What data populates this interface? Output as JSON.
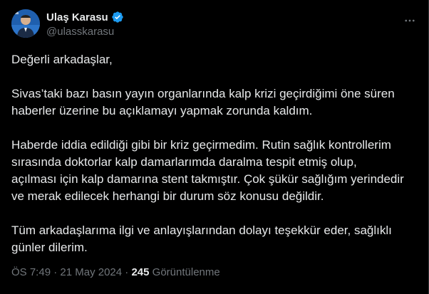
{
  "author": {
    "display_name": "Ulaş Karasu",
    "handle": "@ulasskarasu",
    "verified": true
  },
  "tweet": {
    "paragraphs": [
      "Değerli arkadaşlar,",
      "Sivas’taki bazı basın yayın organlarında kalp krizi geçirdiğimi öne süren\nhaberler üzerine bu açıklamayı yapmak zorunda kaldım.",
      "Haberde iddia edildiği gibi bir kriz geçirmedim. Rutin sağlık kontrollerim\nsırasında doktorlar kalp damarlarımda daralma tespit etmiş olup,\naçılması için kalp damarına stent takmıştır. Çok şükür sağlığım yerindedir\nve merak edilecek herhangi bir durum söz konusu değildir.",
      "Tüm arkadaşlarıma ilgi ve anlayışlarından dolayı teşekkür eder, sağlıklı\ngünler dilerim."
    ]
  },
  "meta": {
    "time": "ÖS 7:49",
    "separator": " · ",
    "date": "21 May 2024",
    "views_count": "245",
    "views_label": " Görüntülenme"
  },
  "icons": {
    "verified": "verified-badge-icon",
    "more": "more-options-icon"
  },
  "colors": {
    "background": "#000000",
    "text": "#e7e9ea",
    "secondary": "#71767b",
    "verified": "#1d9bf0"
  }
}
